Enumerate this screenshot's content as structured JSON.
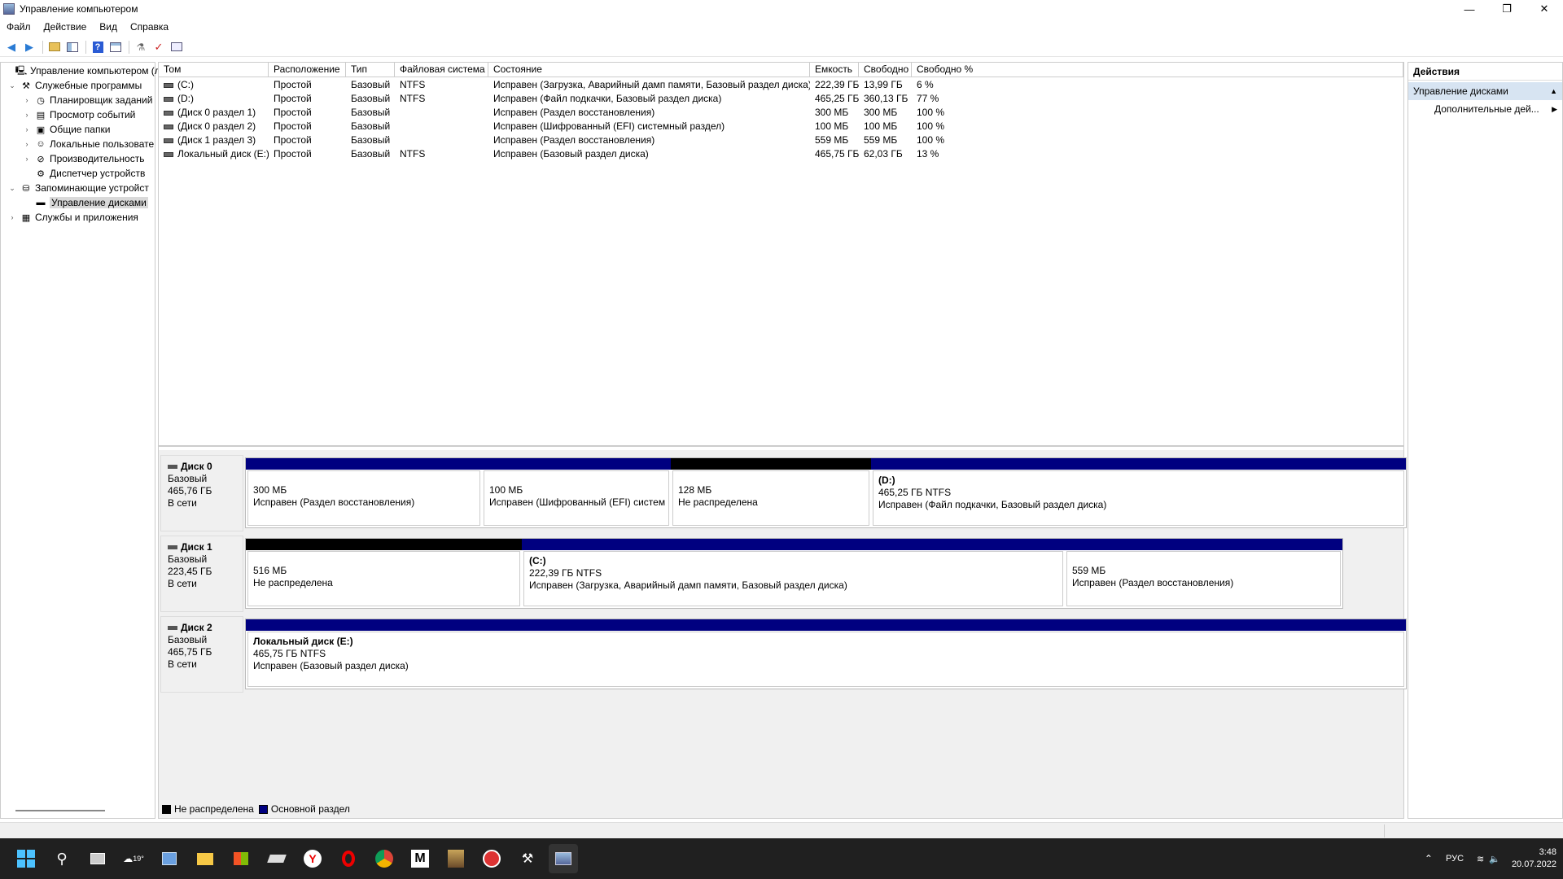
{
  "window": {
    "title": "Управление компьютером",
    "minimize": "—",
    "maximize": "❐",
    "close": "✕"
  },
  "menu": [
    "Файл",
    "Действие",
    "Вид",
    "Справка"
  ],
  "tree": [
    {
      "label": "Управление компьютером (л",
      "level": 0,
      "twisty": "",
      "icon": "computer-icon"
    },
    {
      "label": "Служебные программы",
      "level": 1,
      "twisty": "⌄",
      "icon": "tools-icon"
    },
    {
      "label": "Планировщик заданий",
      "level": 2,
      "twisty": "›",
      "icon": "clock-icon"
    },
    {
      "label": "Просмотр событий",
      "level": 2,
      "twisty": "›",
      "icon": "event-viewer-icon"
    },
    {
      "label": "Общие папки",
      "level": 2,
      "twisty": "›",
      "icon": "shared-folder-icon"
    },
    {
      "label": "Локальные пользовате",
      "level": 2,
      "twisty": "›",
      "icon": "users-icon"
    },
    {
      "label": "Производительность",
      "level": 2,
      "twisty": "›",
      "icon": "performance-icon"
    },
    {
      "label": "Диспетчер устройств",
      "level": 2,
      "twisty": "",
      "icon": "device-manager-icon"
    },
    {
      "label": "Запоминающие устройст",
      "level": 1,
      "twisty": "⌄",
      "icon": "storage-icon"
    },
    {
      "label": "Управление дисками",
      "level": 2,
      "twisty": "",
      "icon": "disk-icon",
      "selected": true
    },
    {
      "label": "Службы и приложения",
      "level": 1,
      "twisty": "›",
      "icon": "services-icon"
    }
  ],
  "table": {
    "headers": [
      "Том",
      "Расположение",
      "Тип",
      "Файловая система",
      "Состояние",
      "Емкость",
      "Свободно",
      "Свободно %"
    ],
    "rows": [
      [
        "(C:)",
        "Простой",
        "Базовый",
        "NTFS",
        "Исправен (Загрузка, Аварийный дамп памяти, Базовый раздел диска)",
        "222,39 ГБ",
        "13,99 ГБ",
        "6 %"
      ],
      [
        "(D:)",
        "Простой",
        "Базовый",
        "NTFS",
        "Исправен (Файл подкачки, Базовый раздел диска)",
        "465,25 ГБ",
        "360,13 ГБ",
        "77 %"
      ],
      [
        "(Диск 0 раздел 1)",
        "Простой",
        "Базовый",
        "",
        "Исправен (Раздел восстановления)",
        "300 МБ",
        "300 МБ",
        "100 %"
      ],
      [
        "(Диск 0 раздел 2)",
        "Простой",
        "Базовый",
        "",
        "Исправен (Шифрованный (EFI) системный раздел)",
        "100 МБ",
        "100 МБ",
        "100 %"
      ],
      [
        "(Диск 1 раздел 3)",
        "Простой",
        "Базовый",
        "",
        "Исправен (Раздел восстановления)",
        "559 МБ",
        "559 МБ",
        "100 %"
      ],
      [
        "Локальный диск (E:)",
        "Простой",
        "Базовый",
        "NTFS",
        "Исправен (Базовый раздел диска)",
        "465,75 ГБ",
        "62,03 ГБ",
        "13 %"
      ]
    ]
  },
  "disks": [
    {
      "name": "Диск 0",
      "type": "Базовый",
      "size": "465,76 ГБ",
      "status": "В сети",
      "partitions": [
        {
          "title": "",
          "size": "300 МБ",
          "status": "Исправен (Раздел восстановления)",
          "kind": "blue"
        },
        {
          "title": "",
          "size": "100 МБ",
          "status": "Исправен (Шифрованный (EFI) систем",
          "kind": "blue"
        },
        {
          "title": "",
          "size": "128 МБ",
          "status": "Не распределена",
          "kind": "black"
        },
        {
          "title": "(D:)",
          "size": "465,25 ГБ NTFS",
          "status": "Исправен (Файл подкачки, Базовый раздел диска)",
          "kind": "blue"
        }
      ]
    },
    {
      "name": "Диск 1",
      "type": "Базовый",
      "size": "223,45 ГБ",
      "status": "В сети",
      "partitions": [
        {
          "title": "",
          "size": "516 МБ",
          "status": "Не распределена",
          "kind": "black"
        },
        {
          "title": "(C:)",
          "size": "222,39 ГБ NTFS",
          "status": "Исправен (Загрузка, Аварийный дамп памяти, Базовый раздел диска)",
          "kind": "blue"
        },
        {
          "title": "",
          "size": "559 МБ",
          "status": "Исправен (Раздел восстановления)",
          "kind": "blue"
        }
      ]
    },
    {
      "name": "Диск 2",
      "type": "Базовый",
      "size": "465,75 ГБ",
      "status": "В сети",
      "partitions": [
        {
          "title": "Локальный диск  (E:)",
          "size": "465,75 ГБ NTFS",
          "status": "Исправен (Базовый раздел диска)",
          "kind": "blue"
        }
      ]
    }
  ],
  "legend": [
    {
      "label": "Не распределена",
      "color": "#000000"
    },
    {
      "label": "Основной раздел",
      "color": "#000080"
    }
  ],
  "actions": {
    "header": "Действия",
    "section": "Управление дисками",
    "item": "Дополнительные дей..."
  },
  "taskbar": {
    "weather": "19°",
    "lang": "РУС",
    "time": "3:48",
    "date": "20.07.2022"
  },
  "colors": {
    "primary_partition": "#000080",
    "unallocated": "#000000",
    "selection": "#d7e4f2"
  }
}
